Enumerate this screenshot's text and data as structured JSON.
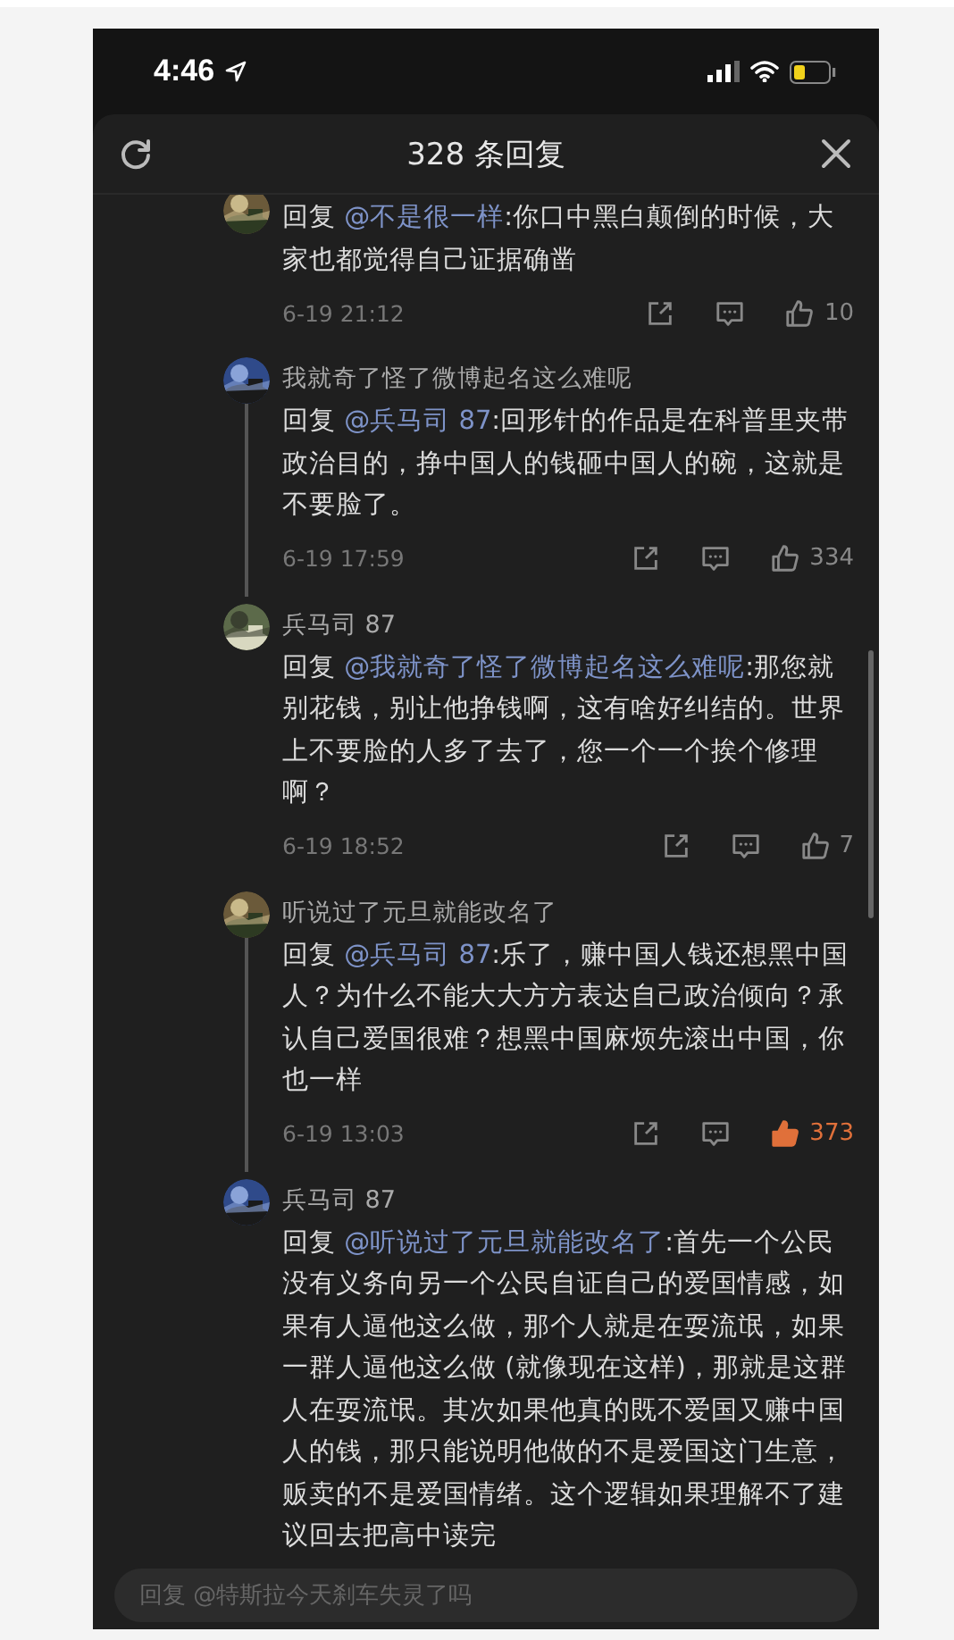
{
  "status_bar": {
    "time": "4:46"
  },
  "header": {
    "title": "328 条回复"
  },
  "comments": [
    {
      "prefix": "回复",
      "mention": "@不是很一样",
      "text": ":你口中黑白颠倒的时候，大家也都觉得自己证据确凿",
      "time": "6-19 21:12",
      "likes": "10",
      "liked": false,
      "connector": false
    },
    {
      "name": "我就奇了怪了微博起名这么难呢",
      "prefix": "回复",
      "mention": "@兵马司 87",
      "text": ":回形针的作品是在科普里夹带政治目的，挣中国人的钱砸中国人的碗，这就是不要脸了。",
      "time": "6-19 17:59",
      "likes": "334",
      "liked": false,
      "connector": true
    },
    {
      "name": "兵马司 87",
      "prefix": "回复",
      "mention": "@我就奇了怪了微博起名这么难呢",
      "text": ":那您就别花钱，别让他挣钱啊，这有啥好纠结的。世界上不要脸的人多了去了，您一个一个挨个修理啊？",
      "time": "6-19 18:52",
      "likes": "7",
      "liked": false,
      "connector": false
    },
    {
      "name": "听说过了元旦就能改名了",
      "prefix": "回复",
      "mention": "@兵马司 87",
      "text": ":乐了，赚中国人钱还想黑中国人？为什么不能大大方方表达自己政治倾向？承认自己爱国很难？想黑中国麻烦先滚出中国，你也一样",
      "time": "6-19 13:03",
      "likes": "373",
      "liked": true,
      "connector": true
    },
    {
      "name": "兵马司 87",
      "prefix": "回复",
      "mention": "@听说过了元旦就能改名了",
      "text": ":首先一个公民没有义务向另一个公民自证自己的爱国情感，如果有人逼他这么做，那个人就是在耍流氓，如果一群人逼他这么做 (就像现在这样)，那就是这群人在耍流氓。其次如果他真的既不爱国又赚中国人的钱，那只能说明他做的不是爱国这门生意，贩卖的不是爱国情绪。这个逻辑如果理解不了建议回去把高中读完",
      "connector": false
    }
  ],
  "reply_box": {
    "placeholder": "回复 @特斯拉今天刹车失灵了吗"
  }
}
